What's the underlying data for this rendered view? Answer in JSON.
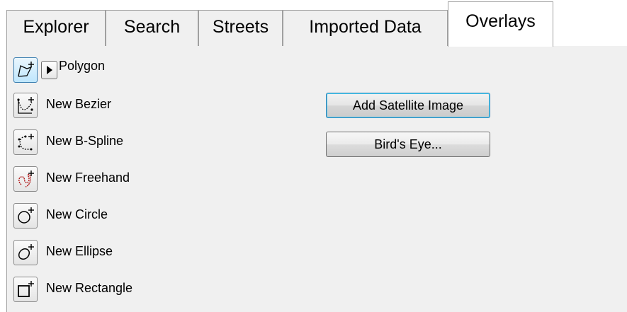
{
  "tabs": [
    {
      "label": "Explorer",
      "active": false
    },
    {
      "label": "Search",
      "active": false
    },
    {
      "label": "Streets",
      "active": false
    },
    {
      "label": "Imported Data",
      "active": false
    },
    {
      "label": "Overlays",
      "active": true
    }
  ],
  "tools": {
    "polygon": {
      "label": "Polygon",
      "icon": "polygon-tool-icon"
    },
    "bezier": {
      "label": "New Bezier",
      "icon": "bezier-tool-icon"
    },
    "bspline": {
      "label": "New B-Spline",
      "icon": "bspline-tool-icon"
    },
    "freehand": {
      "label": "New Freehand",
      "icon": "freehand-tool-icon"
    },
    "circle": {
      "label": "New Circle",
      "icon": "circle-tool-icon"
    },
    "ellipse": {
      "label": "New Ellipse",
      "icon": "ellipse-tool-icon"
    },
    "rectangle": {
      "label": "New Rectangle",
      "icon": "rectangle-tool-icon"
    }
  },
  "buttons": {
    "add_satellite": "Add Satellite Image",
    "birds_eye": "Bird's Eye..."
  },
  "colors": {
    "selected_accent": "#3c7fb1",
    "freehand_stroke": "#b01818",
    "panel_background": "#f0f0f0"
  }
}
